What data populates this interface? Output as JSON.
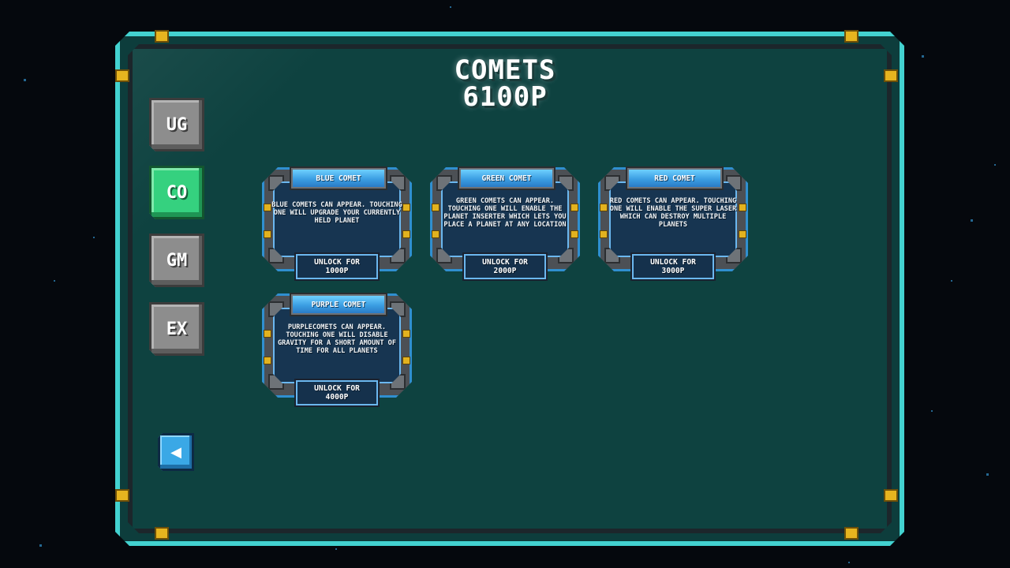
{
  "header": {
    "category": "COMETS",
    "points": "6100P"
  },
  "tabs": [
    {
      "label": "UG",
      "active": false
    },
    {
      "label": "CO",
      "active": true
    },
    {
      "label": "GM",
      "active": false
    },
    {
      "label": "EX",
      "active": false
    }
  ],
  "back_button": {
    "icon": "back-arrow-icon",
    "glyph": "◀"
  },
  "comets": [
    {
      "title": "BLUE COMET",
      "description": "BLUE COMETS CAN APPEAR. TOUCHING ONE WILL UPGRADE YOUR CURRENTLY HELD PLANET",
      "unlock_label": "UNLOCK FOR",
      "cost": "1000P"
    },
    {
      "title": "GREEN COMET",
      "description": "GREEN COMETS CAN APPEAR. TOUCHING ONE WILL ENABLE THE PLANET INSERTER WHICH LETS YOU PLACE A PLANET AT ANY LOCATION",
      "unlock_label": "UNLOCK FOR",
      "cost": "2000P"
    },
    {
      "title": "RED COMET",
      "description": "RED COMETS CAN APPEAR. TOUCHING ONE WILL ENABLE THE SUPER LASER WHICH CAN DESTROY MULTIPLE PLANETS",
      "unlock_label": "UNLOCK FOR",
      "cost": "3000P"
    },
    {
      "title": "PURPLE COMET",
      "description": "PURPLECOMETS CAN APPEAR. TOUCHING ONE WILL DISABLE GRAVITY FOR A SHORT AMOUNT OF TIME FOR ALL PLANETS",
      "unlock_label": "UNLOCK FOR",
      "cost": "4000P"
    }
  ],
  "colors": {
    "panel": "#0e4240",
    "frame": "#43d2d0",
    "active_tab": "#35d17f",
    "inactive_tab": "#8d8d8d",
    "card_title": "#3b9ee2",
    "bolt": "#e6b41f"
  }
}
